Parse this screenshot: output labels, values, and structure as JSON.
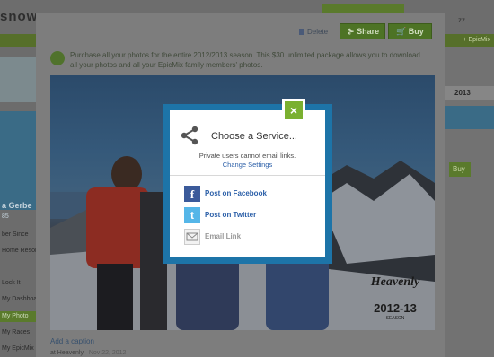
{
  "background": {
    "logo": "snow.com",
    "nav_right": "+ EpicMix",
    "left_panel": {
      "name": "a Gerbe",
      "sub": "85",
      "items": [
        "ber Since",
        "Home Resort",
        "Lock It",
        "My Dashboa",
        "My Photo",
        "My Races",
        "My EpicMix"
      ]
    },
    "right_panel": {
      "season_select": "2013",
      "button": "Buy"
    }
  },
  "lightbox": {
    "delete_label": "Delete",
    "share_label": "Share",
    "buy_label": "Buy",
    "notice": "Purchase all your photos for the entire 2012/2013 season. This $30 unlimited package allows you to download all your photos and all your EpicMix family members' photos.",
    "photo_watermark": {
      "brand": "Heavenly",
      "season": "2012-13",
      "season_label": "SEASON"
    },
    "add_caption": "Add a caption",
    "meta_location": "at Heavenly",
    "meta_date": "Nov 22, 2012"
  },
  "modal": {
    "title": "Choose a Service...",
    "note": "Private users cannot email links.",
    "change_settings": "Change Settings",
    "close_glyph": "×",
    "services": [
      {
        "label": "Post on Facebook",
        "icon": "facebook-icon",
        "glyph": "f",
        "enabled": true
      },
      {
        "label": "Post on Twitter",
        "icon": "twitter-icon",
        "glyph": "t",
        "enabled": true
      },
      {
        "label": "Email Link",
        "icon": "envelope-icon",
        "glyph": "",
        "enabled": false
      }
    ]
  },
  "colors": {
    "accent_green": "#7ab030",
    "modal_frame_blue": "#1d74a8",
    "link_blue": "#2b5fa8",
    "facebook_blue": "#3b5a9a",
    "twitter_blue": "#55b6e8"
  }
}
